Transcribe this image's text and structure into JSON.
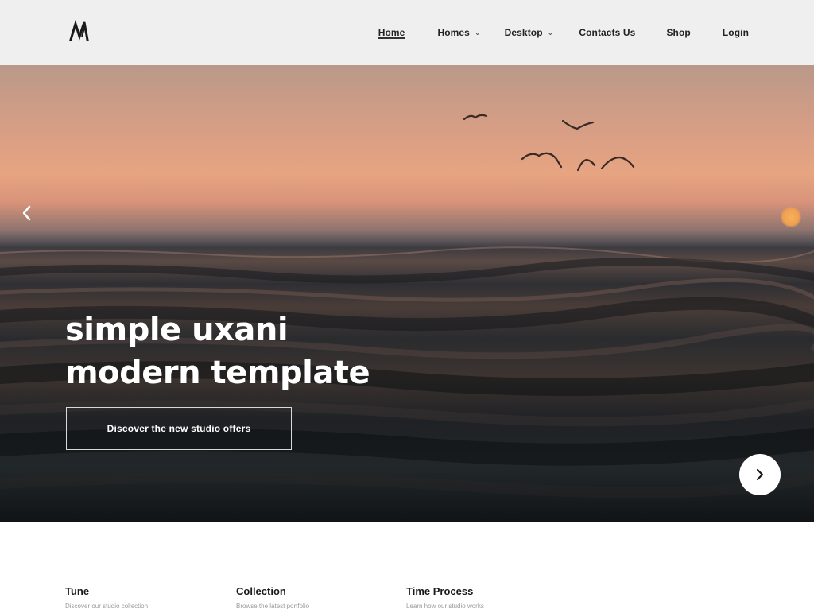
{
  "header": {
    "logo_text": "M",
    "nav": [
      {
        "label": "Home",
        "active": true
      },
      {
        "label": "Homes",
        "dropdown": true
      },
      {
        "label": "Desktop",
        "dropdown": true
      },
      {
        "label": "Contacts Us"
      },
      {
        "label": "Shop"
      },
      {
        "label": "Login"
      }
    ]
  },
  "hero": {
    "title_line1": "simple uxani",
    "title_line2": "modern template",
    "cta_label": "Discover the new studio offers",
    "prev_icon": "chevron-left-icon",
    "next_icon": "chevron-right-icon"
  },
  "features": [
    {
      "title": "Tune",
      "subtitle": "Discover our studio collection"
    },
    {
      "title": "Collection",
      "subtitle": "Browse the latest portfolio"
    },
    {
      "title": "Time Process",
      "subtitle": "Learn how our studio works"
    }
  ],
  "colors": {
    "header_bg": "#efefef",
    "sky_top": "#b99889",
    "sky_glow": "#e7a481",
    "sun": "#f0a04f",
    "water_dark": "#101416"
  }
}
